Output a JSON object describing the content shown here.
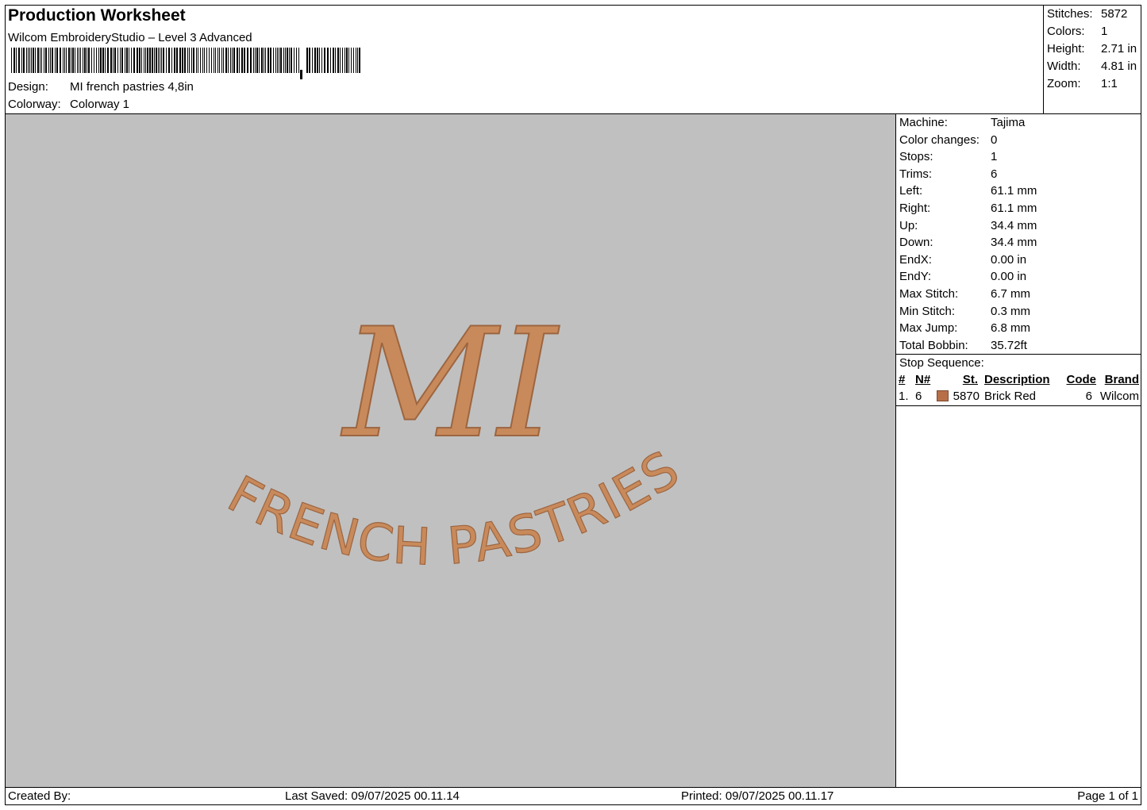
{
  "header": {
    "title": "Production Worksheet",
    "subtitle": "Wilcom EmbroideryStudio – Level 3 Advanced",
    "design_label": "Design:",
    "design_value": "MI french pastries 4,8in",
    "colorway_label": "Colorway:",
    "colorway_value": "Colorway 1"
  },
  "summary": {
    "stitches_label": "Stitches:",
    "stitches_value": "5872",
    "colors_label": "Colors:",
    "colors_value": "1",
    "height_label": "Height:",
    "height_value": "2.71 in",
    "width_label": "Width:",
    "width_value": "4.81 in",
    "zoom_label": "Zoom:",
    "zoom_value": "1:1"
  },
  "machine_info": [
    {
      "label": "Machine:",
      "value": "Tajima"
    },
    {
      "label": "Color changes:",
      "value": "0"
    },
    {
      "label": "Stops:",
      "value": "1"
    },
    {
      "label": "Trims:",
      "value": "6"
    },
    {
      "label": "Left:",
      "value": "61.1 mm"
    },
    {
      "label": "Right:",
      "value": "61.1 mm"
    },
    {
      "label": "Up:",
      "value": "34.4 mm"
    },
    {
      "label": "Down:",
      "value": "34.4 mm"
    },
    {
      "label": "EndX:",
      "value": "0.00 in"
    },
    {
      "label": "EndY:",
      "value": "0.00 in"
    },
    {
      "label": "Max Stitch:",
      "value": "6.7 mm"
    },
    {
      "label": "Min Stitch:",
      "value": "0.3 mm"
    },
    {
      "label": "Max Jump:",
      "value": "6.8 mm"
    },
    {
      "label": "Total Bobbin:",
      "value": "35.72ft"
    }
  ],
  "stop_sequence": {
    "title": "Stop Sequence:",
    "headers": {
      "num": "#",
      "needle": "N#",
      "st": "St.",
      "description": "Description",
      "code": "Code",
      "brand": "Brand"
    },
    "rows": [
      {
        "num": "1.",
        "needle": "6",
        "st": "5870",
        "description": "Brick Red",
        "code": "6",
        "brand": "Wilcom",
        "color": "#b86f48"
      }
    ]
  },
  "design_preview": {
    "line1": "MI",
    "line2": "FRENCH PASTRIES",
    "background": "#c0c0c0",
    "thread_color": "#c98a5b"
  },
  "footer": {
    "created_by": "Created By:",
    "last_saved": "Last Saved: 09/07/2025 00.11.14",
    "printed": "Printed: 09/07/2025 00.11.17",
    "page": "Page 1 of 1"
  }
}
